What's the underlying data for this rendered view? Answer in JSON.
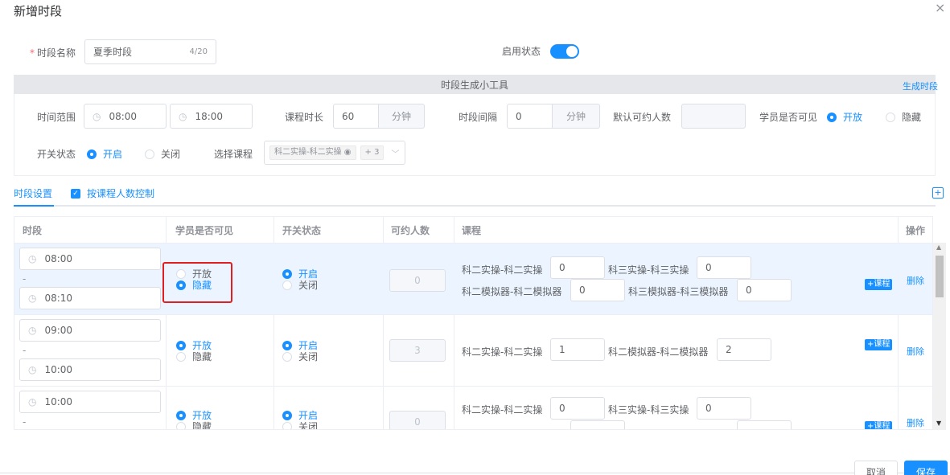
{
  "dialog": {
    "title": "新增时段",
    "close_icon": "×"
  },
  "form": {
    "name_label": "时段名称",
    "name_value": "夏季时段",
    "name_count": "4/20",
    "status_label": "启用状态"
  },
  "tool": {
    "header": "时段生成小工具",
    "generate_link": "生成时段",
    "time_range_label": "时间范围",
    "start_time": "08:00",
    "end_time": "18:00",
    "duration_label": "课程时长",
    "duration_value": "60",
    "duration_unit": "分钟",
    "interval_label": "时段间隔",
    "interval_value": "0",
    "interval_unit": "分钟",
    "default_count_label": "默认可约人数",
    "visible_label": "学员是否可见",
    "visible_open": "开放",
    "visible_hidden": "隐藏",
    "switch_label": "开关状态",
    "switch_on": "开启",
    "switch_off": "关闭",
    "course_label": "选择课程",
    "course_tag": "科二实操-科二实操",
    "course_more": "+ 3"
  },
  "tabs": {
    "active": "时段设置",
    "checkbox_label": "按课程人数控制"
  },
  "table": {
    "headers": [
      "时段",
      "学员是否可见",
      "开关状态",
      "可约人数",
      "课程",
      "操作"
    ],
    "rows": [
      {
        "start": "08:00",
        "sep": "-",
        "end": "08:10",
        "visible_open": "开放",
        "visible_hidden": "隐藏",
        "switch_on": "开启",
        "switch_off": "关闭",
        "count": "0",
        "courses": [
          {
            "name": "科二实操-科二实操",
            "value": "0"
          },
          {
            "name": "科三实操-科三实操",
            "value": "0"
          },
          {
            "name": "科二模拟器-科二模拟器",
            "value": "0"
          },
          {
            "name": "科三模拟器-科三模拟器",
            "value": "0"
          }
        ],
        "add_course": "+课程",
        "delete": "删除"
      },
      {
        "start": "09:00",
        "sep": "-",
        "end": "10:00",
        "visible_open": "开放",
        "visible_hidden": "隐藏",
        "switch_on": "开启",
        "switch_off": "关闭",
        "count": "3",
        "courses": [
          {
            "name": "科二实操-科二实操",
            "value": "1"
          },
          {
            "name": "科二模拟器-科二模拟器",
            "value": "2"
          }
        ],
        "add_course": "+课程",
        "delete": "删除"
      },
      {
        "start": "10:00",
        "sep": "-",
        "visible_open": "开放",
        "visible_hidden": "隐藏",
        "switch_on": "开启",
        "switch_off": "关闭",
        "count": "0",
        "courses": [
          {
            "name": "科二实操-科二实操",
            "value": "0"
          },
          {
            "name": "科三实操-科三实操",
            "value": "0"
          }
        ],
        "add_course": "+课程",
        "delete": "删除"
      }
    ]
  },
  "footer": {
    "cancel": "取消",
    "save": "保存"
  },
  "colors": {
    "accent": "#1890ff",
    "highlight_border": "#e02020"
  }
}
